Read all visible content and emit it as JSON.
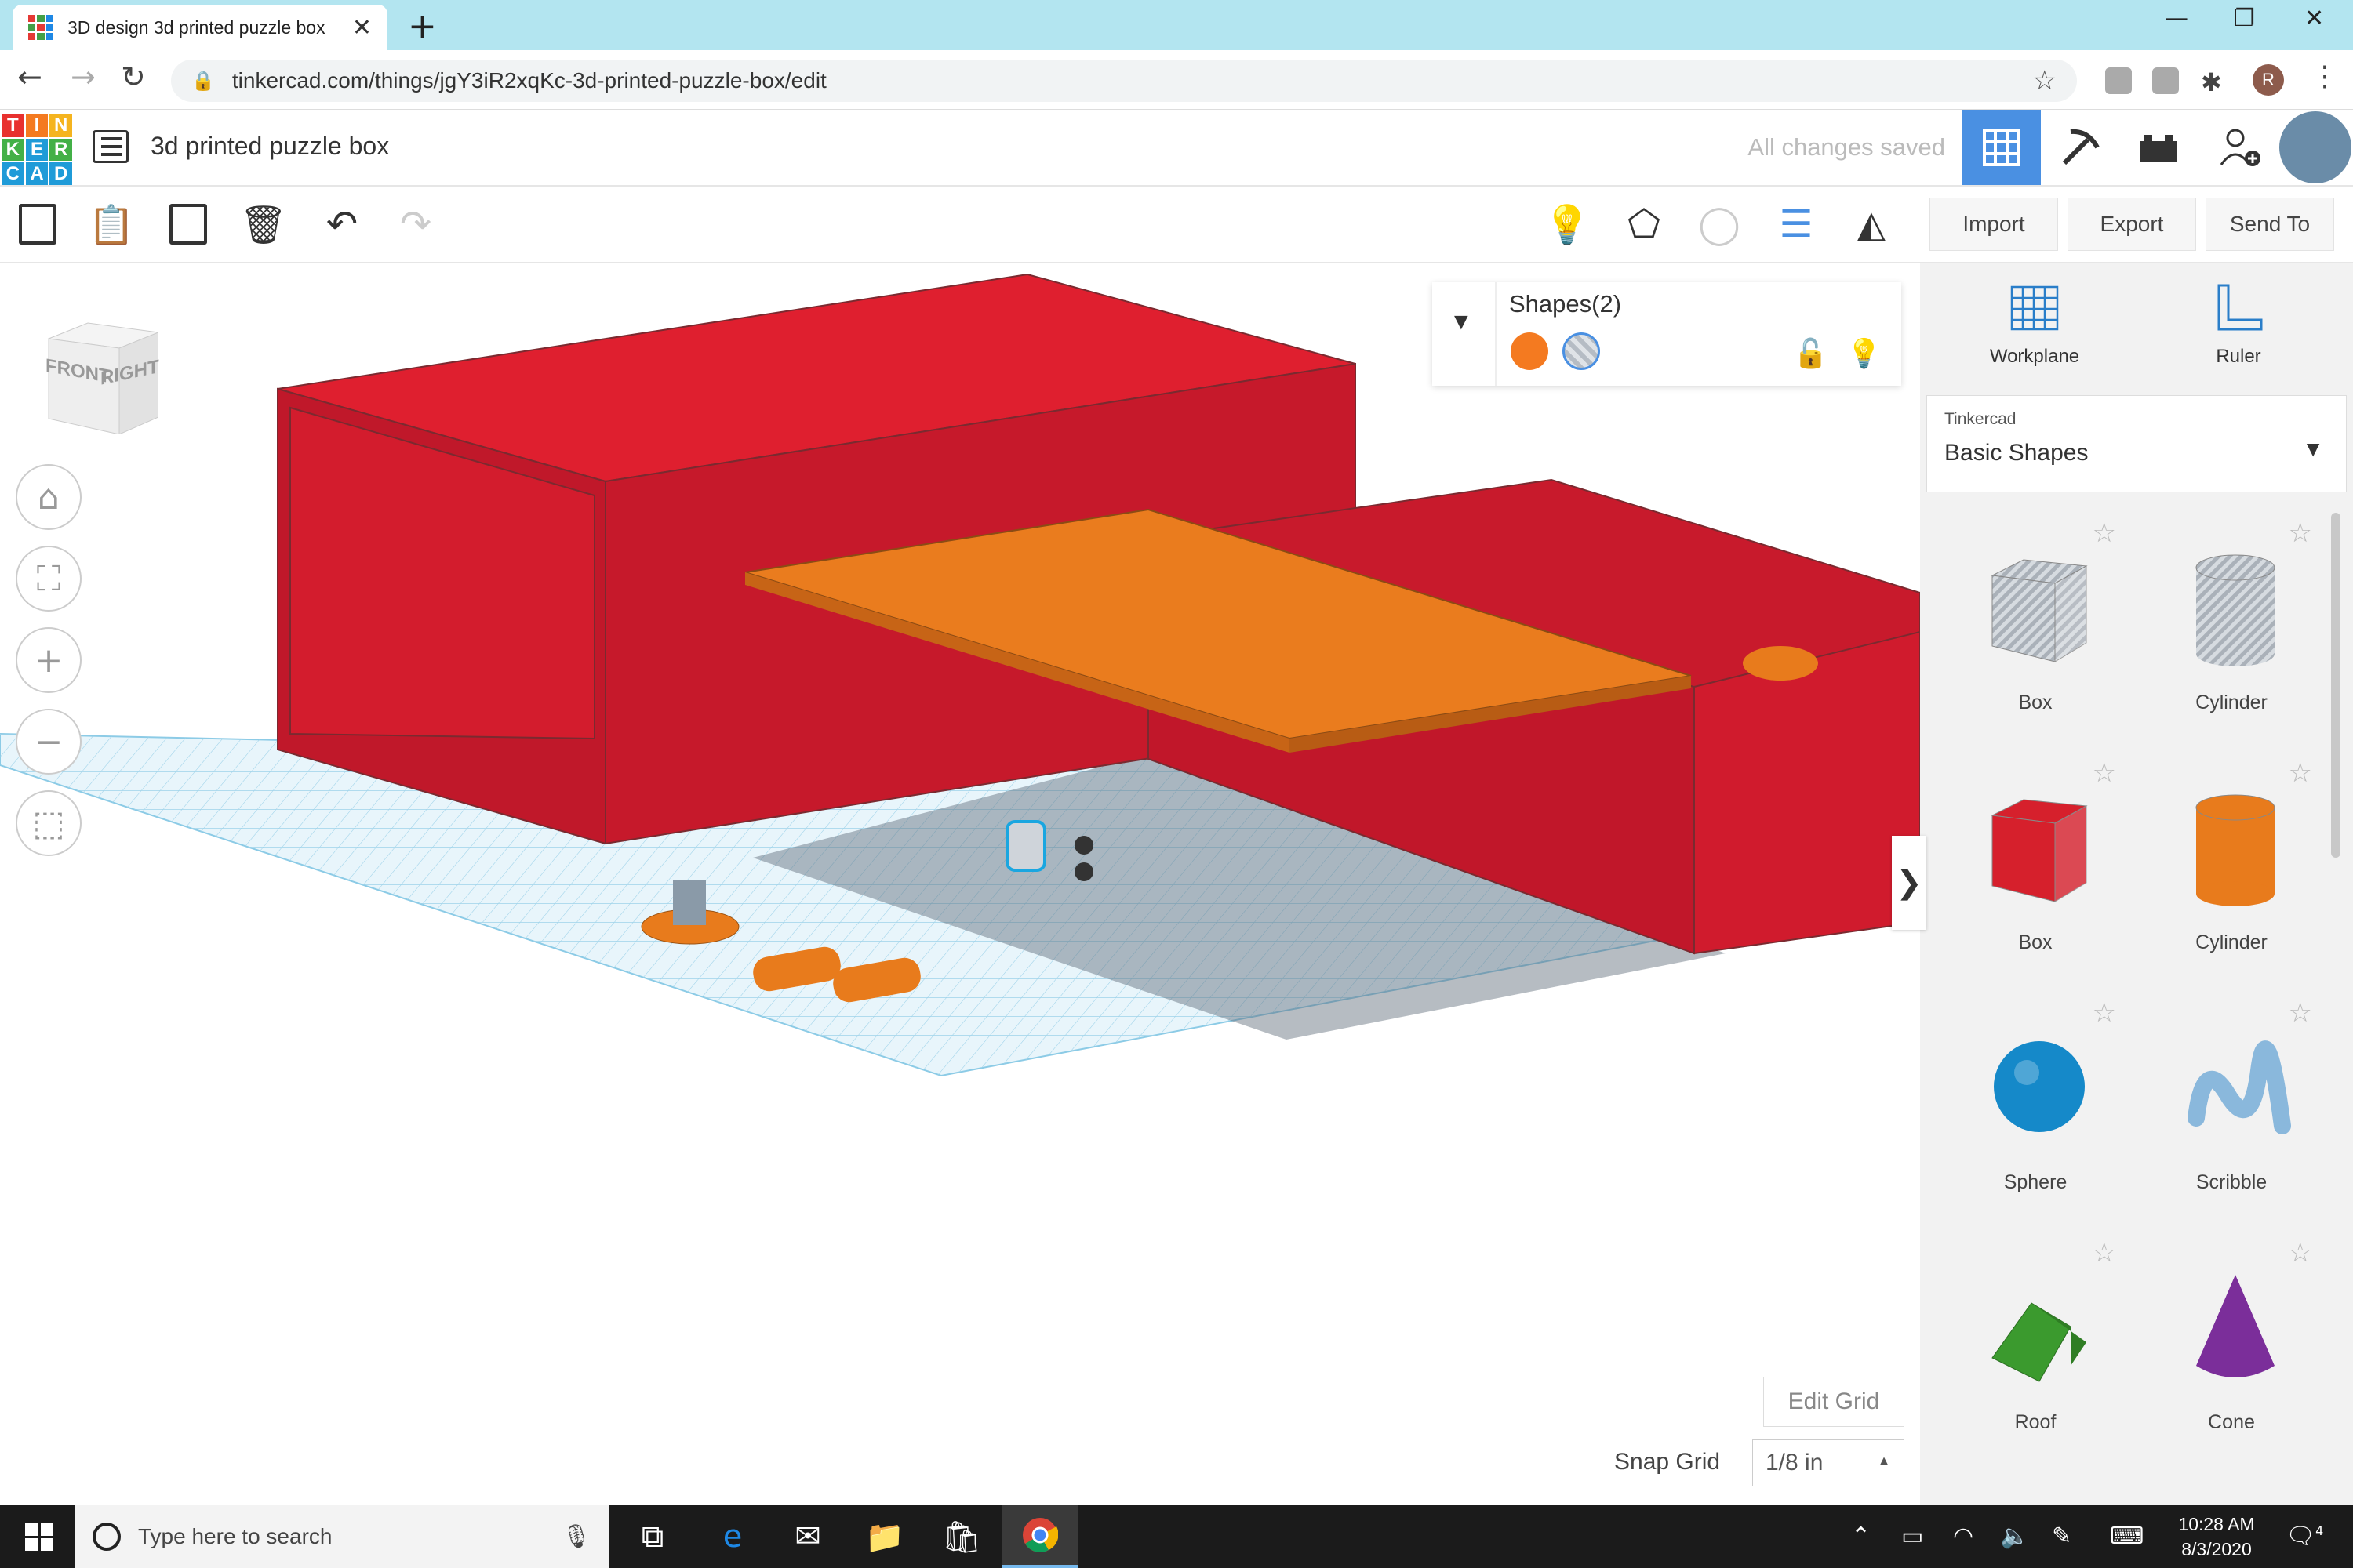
{
  "browser": {
    "tab_title": "3D design 3d printed puzzle box",
    "tab_close": "✕",
    "new_tab": "+",
    "url": "tinkercad.com/things/jgY3iR2xqKc-3d-printed-puzzle-box/edit",
    "profile_initial": "R",
    "icons": [
      "back-arrow-icon",
      "forward-arrow-icon",
      "reload-icon",
      "lock-icon",
      "star-icon",
      "extensions-icon",
      "kebab-menu-icon"
    ]
  },
  "header": {
    "logo_letters": [
      "T",
      "I",
      "N",
      "K",
      "E",
      "R",
      "C",
      "A",
      "D"
    ],
    "logo_colors": [
      "#e8312f",
      "#f47a20",
      "#f5b41f",
      "#43b047",
      "#1f9bd8",
      "#43b047",
      "#1f9bd8",
      "#1f9bd8",
      "#1f9bd8"
    ],
    "design_title": "3d printed puzzle box",
    "save_status": "All changes saved",
    "accent_color": "#4a90e2"
  },
  "toolbar": {
    "import_label": "Import",
    "export_label": "Export",
    "sendto_label": "Send To"
  },
  "viewcube": {
    "front": "FRONT",
    "right": "RIGHT"
  },
  "inspector": {
    "label": "Shapes(2)",
    "solid_color": "#f47a20"
  },
  "sidepanel": {
    "workplane_label": "Workplane",
    "ruler_label": "Ruler",
    "library_source": "Tinkercad",
    "library_name": "Basic Shapes",
    "shapes": [
      {
        "name": "Box",
        "style": "hole"
      },
      {
        "name": "Cylinder",
        "style": "hole"
      },
      {
        "name": "Box",
        "style": "solid",
        "color": "#d6202c"
      },
      {
        "name": "Cylinder",
        "style": "solid",
        "color": "#e87b1c"
      },
      {
        "name": "Sphere",
        "style": "solid",
        "color": "#1589c9"
      },
      {
        "name": "Scribble",
        "style": "solid",
        "color": "#8ab8dc"
      },
      {
        "name": "Roof",
        "style": "solid",
        "color": "#3b9a2e"
      },
      {
        "name": "Cone",
        "style": "solid",
        "color": "#7b2e9a"
      }
    ]
  },
  "grid": {
    "edit_grid_label": "Edit Grid",
    "snap_label": "Snap Grid",
    "snap_value": "1/8 in"
  },
  "taskbar": {
    "search_placeholder": "Type here to search",
    "time": "10:28 AM",
    "date": "8/3/2020",
    "notification_count": "4"
  }
}
